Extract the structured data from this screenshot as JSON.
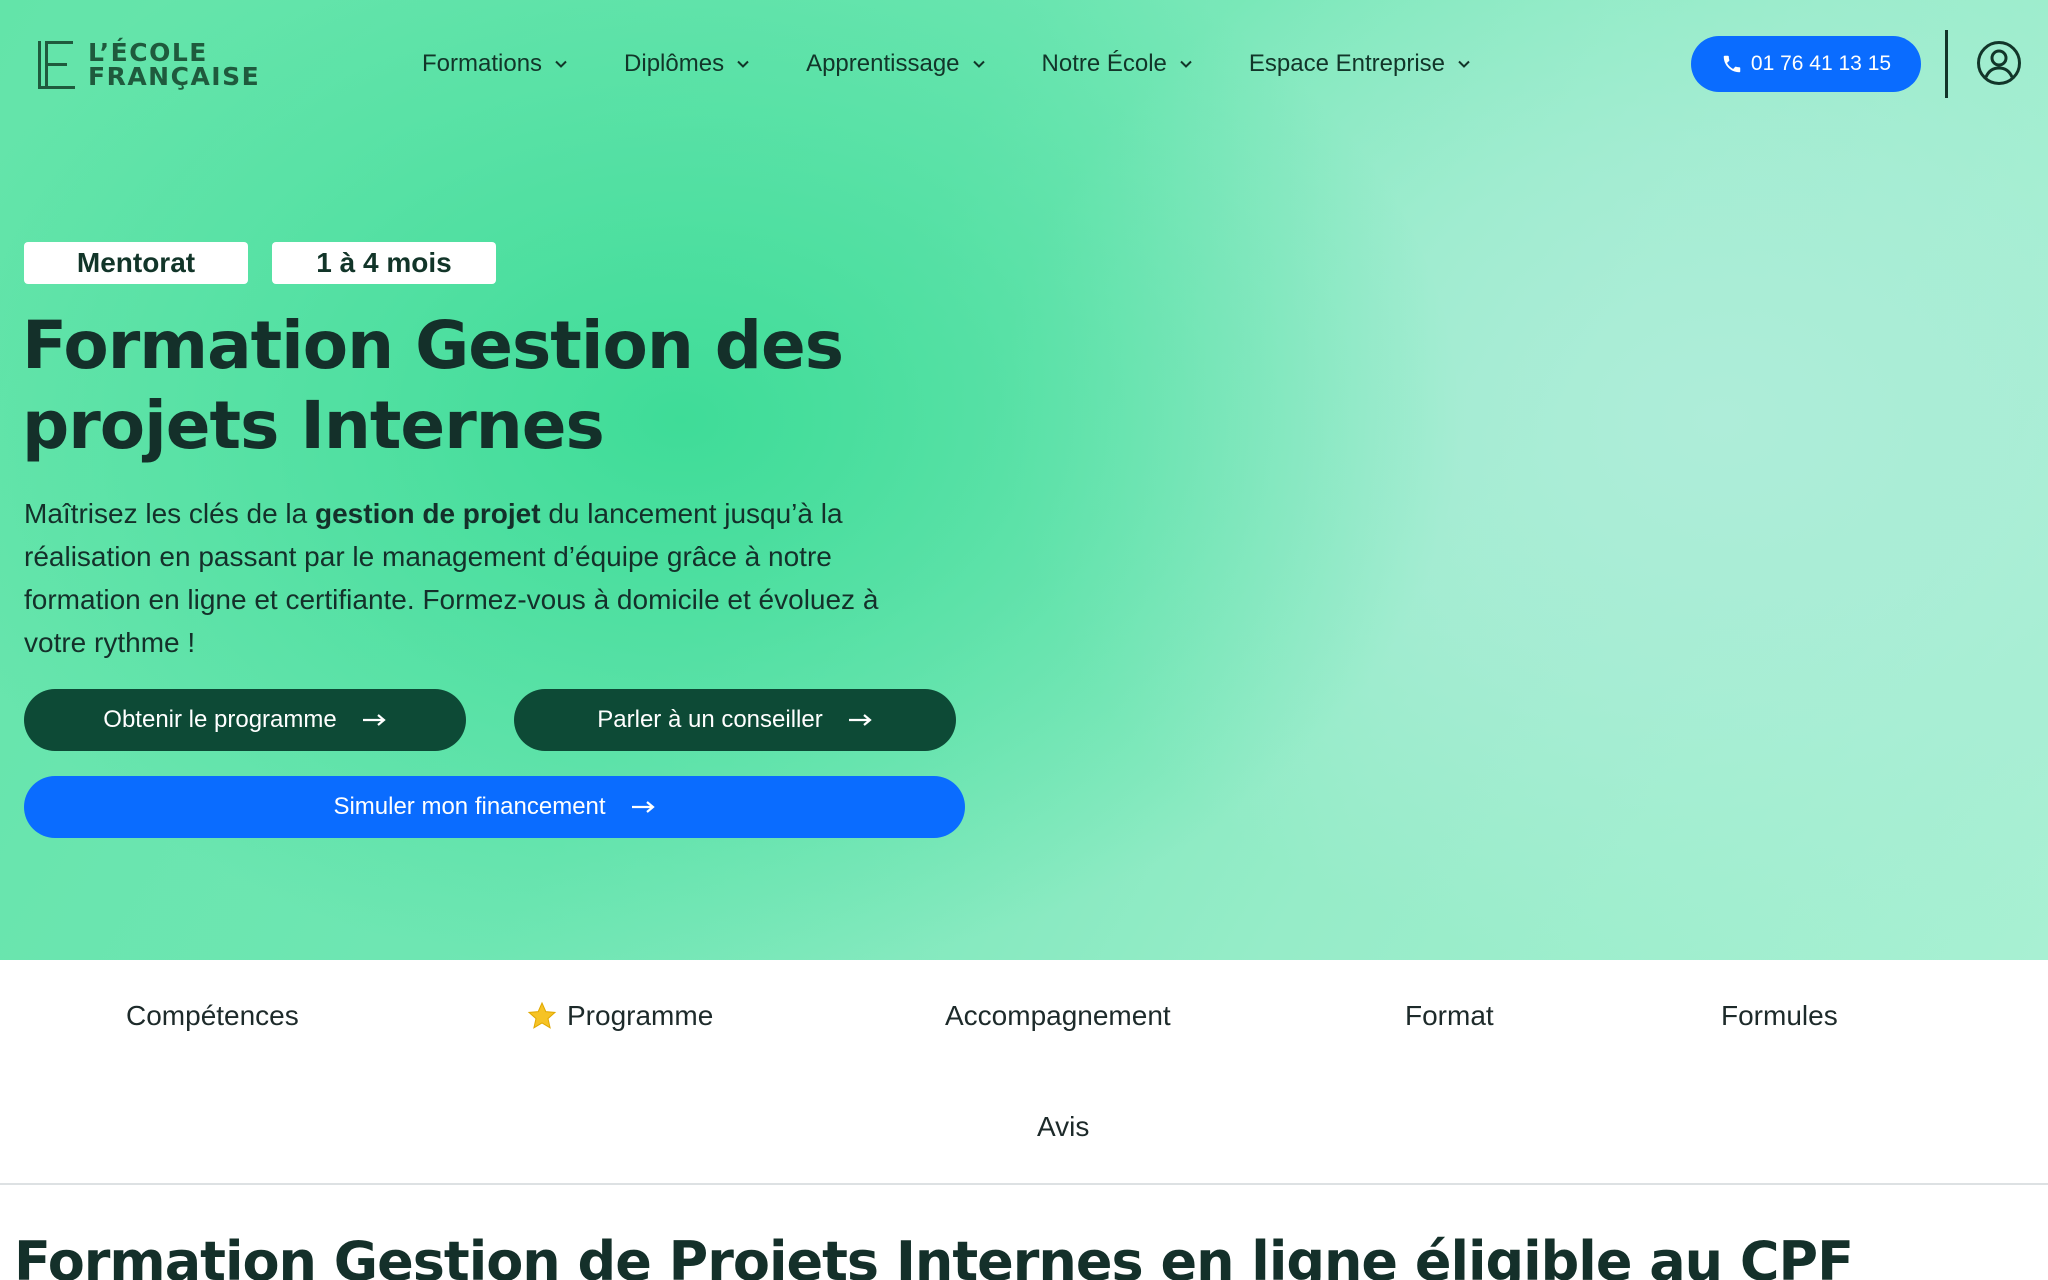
{
  "header": {
    "logo": {
      "line1": "L’ÉCOLE",
      "line2": "FRANÇAISE",
      "monogram": "LE"
    },
    "nav": [
      {
        "label": "Formations",
        "icon": "chevron-down-icon"
      },
      {
        "label": "Diplômes",
        "icon": "chevron-down-icon"
      },
      {
        "label": "Apprentissage",
        "icon": "chevron-down-icon"
      },
      {
        "label": "Notre École",
        "icon": "chevron-down-icon"
      },
      {
        "label": "Espace Entreprise",
        "icon": "chevron-down-icon"
      }
    ],
    "phone": {
      "label": "01 76 41 13 15",
      "icon": "phone-icon"
    },
    "account_icon": "user-circle-icon"
  },
  "hero": {
    "badges": [
      "Mentorat",
      "1 à 4 mois"
    ],
    "title_line1": "Formation Gestion des",
    "title_line2": "projets Internes",
    "description": {
      "before": "Maîtrisez les clés de la ",
      "bold": "gestion de projet",
      "after": " du lancement jusqu’à la réalisation en passant par le management d’équipe grâce à notre formation en ligne et certifiante. Formez-vous à domicile et évoluez à votre rythme !"
    },
    "buttons": {
      "program": "Obtenir le programme",
      "advisor": "Parler à un conseiller",
      "financing": "Simuler mon financement"
    }
  },
  "tabs": [
    {
      "label": "Compétences"
    },
    {
      "label": "Programme",
      "icon": "star-icon"
    },
    {
      "label": "Accompagnement"
    },
    {
      "label": "Format"
    },
    {
      "label": "Formules"
    },
    {
      "label": "Avis"
    }
  ],
  "section": {
    "title": "Formation Gestion de Projets Internes en ligne éligible au CPF"
  },
  "colors": {
    "primary_blue": "#0a6cff",
    "dark_green": "#0d4a36",
    "hero_green": "#3fdc98",
    "text": "#14302a"
  }
}
